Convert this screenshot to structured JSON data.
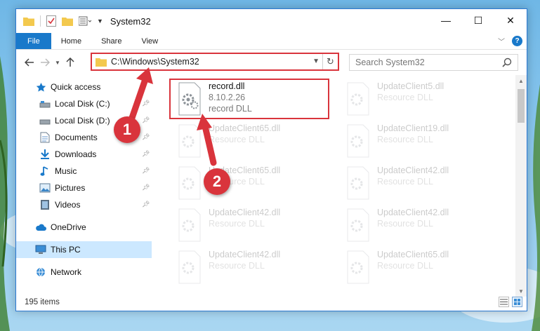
{
  "window": {
    "title": "System32",
    "controls": {
      "minimize": "—",
      "maximize": "☐",
      "close": "✕"
    }
  },
  "ribbon": {
    "tabs": [
      "File",
      "Home",
      "Share",
      "View"
    ]
  },
  "address": {
    "path": "C:\\Windows\\System32",
    "search_placeholder": "Search System32"
  },
  "nav": {
    "quick_access": "Quick access",
    "items": [
      {
        "label": "Local Disk (C:)",
        "icon": "drive-icon"
      },
      {
        "label": "Local Disk (D:)",
        "icon": "drive-icon"
      },
      {
        "label": "Documents",
        "icon": "documents-icon"
      },
      {
        "label": "Downloads",
        "icon": "downloads-icon"
      },
      {
        "label": "Music",
        "icon": "music-icon"
      },
      {
        "label": "Pictures",
        "icon": "pictures-icon"
      },
      {
        "label": "Videos",
        "icon": "videos-icon"
      }
    ],
    "onedrive": "OneDrive",
    "this_pc": "This PC",
    "network": "Network"
  },
  "files": [
    {
      "name": "record.dll",
      "line2": "8.10.2.26",
      "line3": "record DLL",
      "highlighted": true
    },
    {
      "name": "UpdateClient5.dll",
      "line2": "Resource DLL"
    },
    {
      "name": "UpdateClient65.dll",
      "line2": "Resource DLL"
    },
    {
      "name": "UpdateClient19.dll",
      "line2": "Resource DLL"
    },
    {
      "name": "UpdateClient65.dll",
      "line2": "Resource DLL"
    },
    {
      "name": "UpdateClient42.dll",
      "line2": "Resource DLL"
    },
    {
      "name": "UpdateClient42.dll",
      "line2": "Resource DLL"
    },
    {
      "name": "UpdateClient42.dll",
      "line2": "Resource DLL"
    },
    {
      "name": "UpdateClient42.dll",
      "line2": "Resource DLL"
    },
    {
      "name": "UpdateClient65.dll",
      "line2": "Resource DLL"
    }
  ],
  "status": {
    "item_count": "195 items"
  },
  "callouts": {
    "step1": "1",
    "step2": "2"
  },
  "colors": {
    "accent": "#1979ca",
    "highlight": "#d9343c",
    "selected": "#cce8ff"
  }
}
